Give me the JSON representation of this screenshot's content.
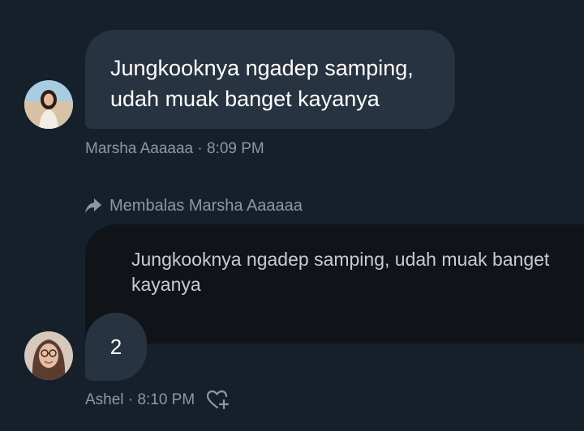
{
  "messages": [
    {
      "text": "Jungkooknya ngadep samping, udah muak banget kayanya",
      "sender": "Marsha Aaaaaa",
      "time": "8:09 PM",
      "meta": "Marsha Aaaaaa · 8:09 PM"
    },
    {
      "reply_label": "Membalas Marsha Aaaaaa",
      "quoted_text": "Jungkooknya ngadep samping, udah muak banget kayanya",
      "text": "2",
      "sender": "Ashel",
      "time": "8:10 PM",
      "meta": "Ashel · 8:10 PM"
    }
  ],
  "icons": {
    "reply": "reply-arrow-icon",
    "react": "heart-plus-icon"
  },
  "colors": {
    "background": "#15202b",
    "bubble": "#273340",
    "quote_background": "#101418",
    "muted_text": "#8b98a5"
  }
}
